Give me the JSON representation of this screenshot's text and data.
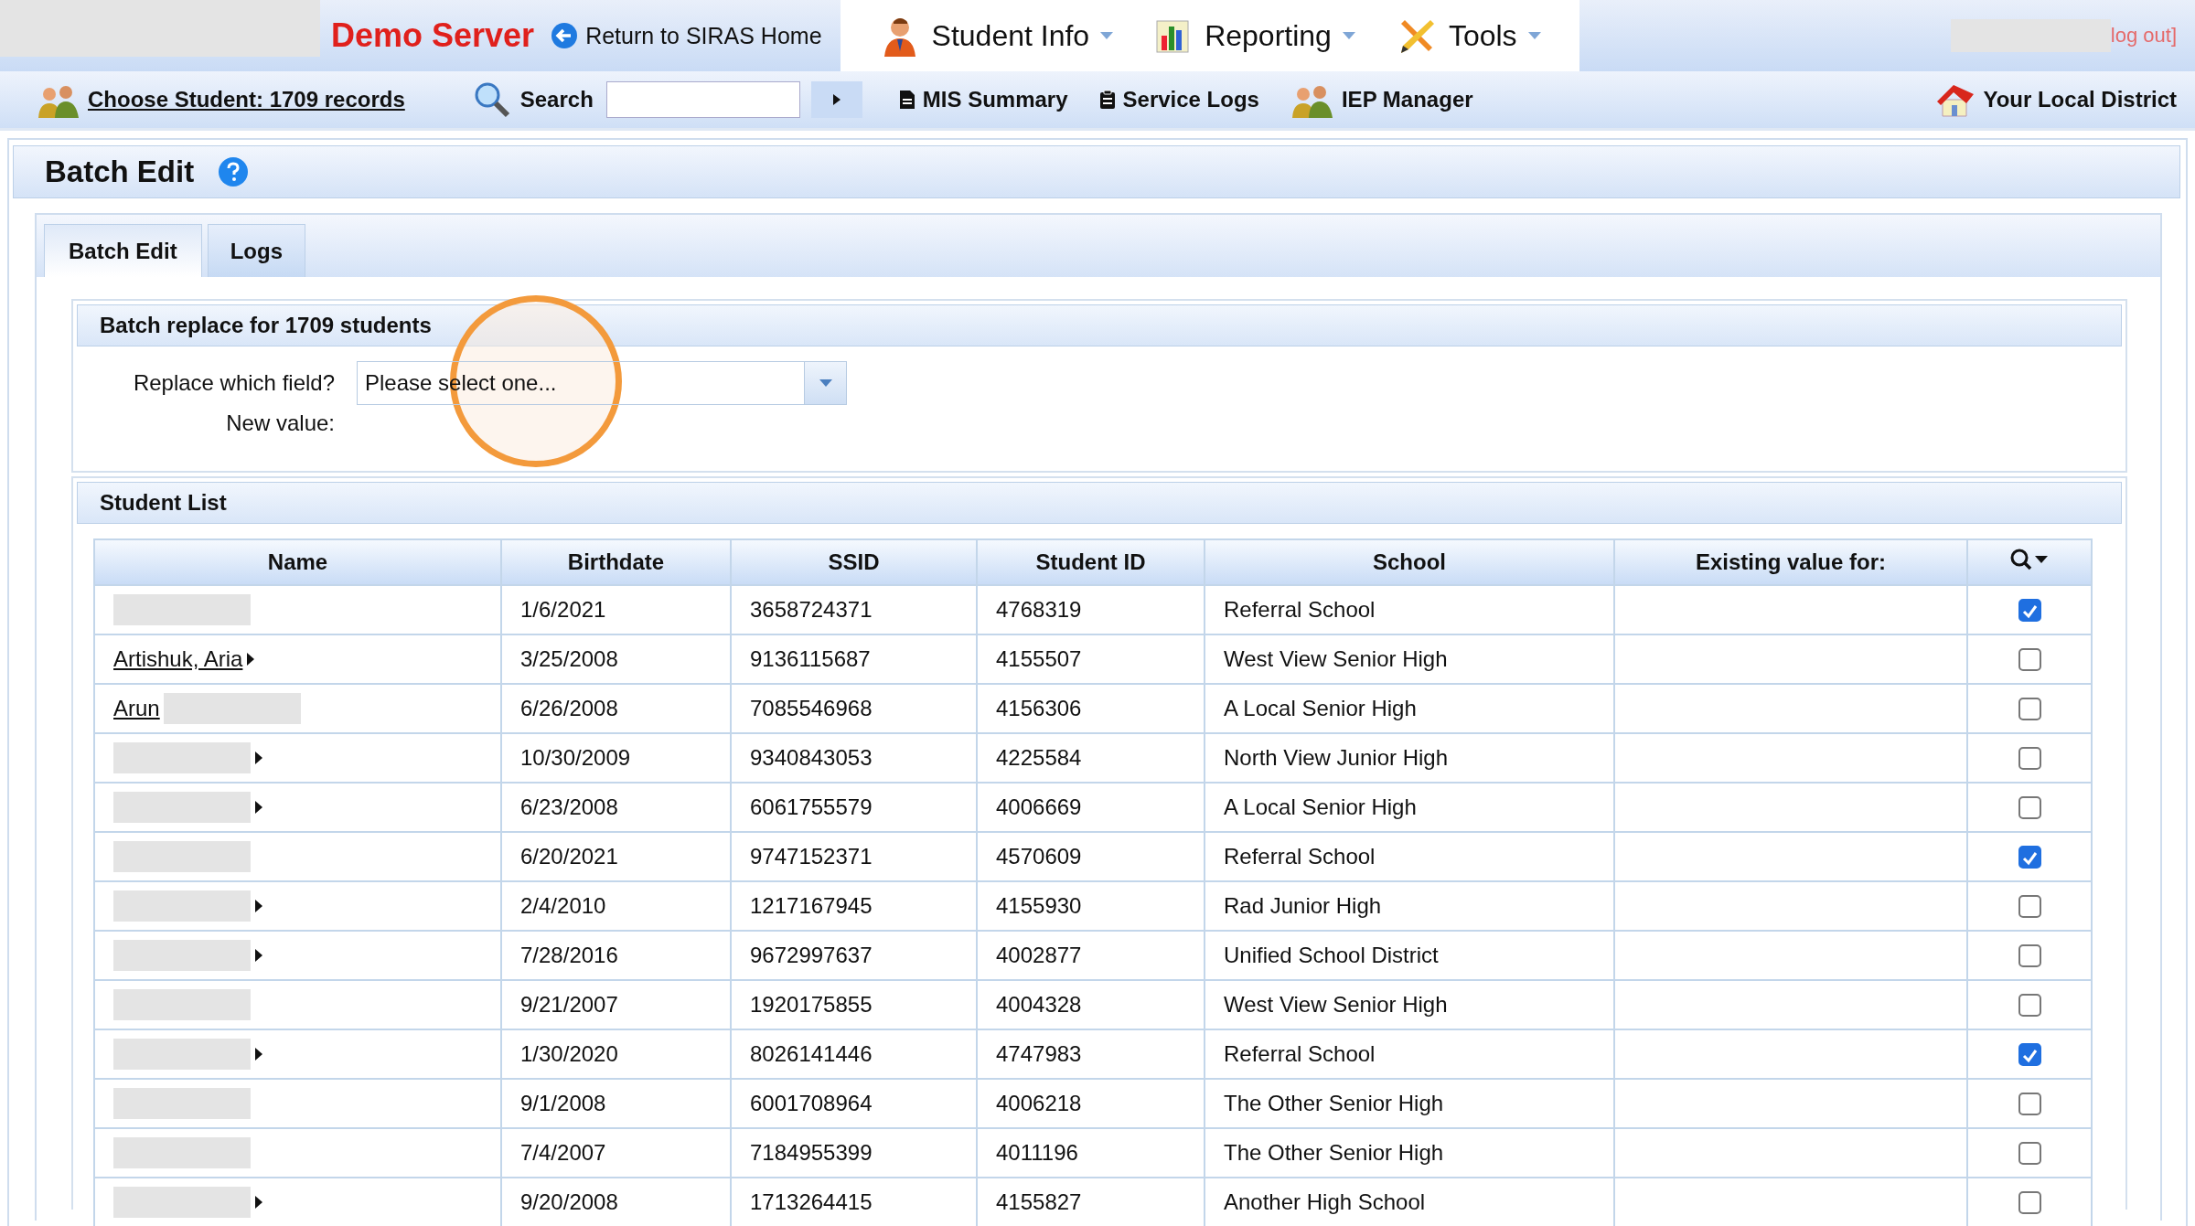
{
  "top_bar": {
    "server_label": "Demo Server",
    "return_link": "Return to SIRAS Home",
    "menus": [
      {
        "label": "Student Info"
      },
      {
        "label": "Reporting"
      },
      {
        "label": "Tools"
      }
    ],
    "logout": "log out]"
  },
  "toolbar": {
    "choose_student": "Choose Student: 1709 records",
    "search_label": "Search",
    "links": [
      {
        "label": "MIS Summary"
      },
      {
        "label": "Service Logs"
      },
      {
        "label": "IEP Manager"
      }
    ],
    "district": "Your Local District"
  },
  "page_title": "Batch Edit",
  "tabs": [
    {
      "label": "Batch Edit",
      "selected": true
    },
    {
      "label": "Logs",
      "selected": false
    }
  ],
  "batch_replace": {
    "title": "Batch replace for 1709 students",
    "field_label": "Replace which field?",
    "field_placeholder": "Please select one...",
    "new_value_label": "New value:"
  },
  "student_list": {
    "title": "Student List",
    "columns": [
      "Name",
      "Birthdate",
      "SSID",
      "Student ID",
      "School",
      "Existing value for:"
    ],
    "rows": [
      {
        "redacted": true,
        "has_menu": false,
        "birthdate": "1/6/2021",
        "ssid": "3658724371",
        "student_id": "4768319",
        "school": "Referral School",
        "checked": true
      },
      {
        "name": "Artishuk, Aria",
        "redacted": false,
        "has_menu": true,
        "birthdate": "3/25/2008",
        "ssid": "9136115687",
        "student_id": "4155507",
        "school": "West View Senior High",
        "checked": false
      },
      {
        "name": "Arun",
        "redacted": true,
        "has_menu": false,
        "birthdate": "6/26/2008",
        "ssid": "7085546968",
        "student_id": "4156306",
        "school": "A Local Senior High",
        "checked": false
      },
      {
        "redacted": true,
        "has_menu": true,
        "birthdate": "10/30/2009",
        "ssid": "9340843053",
        "student_id": "4225584",
        "school": "North View Junior High",
        "checked": false
      },
      {
        "redacted": true,
        "has_menu": true,
        "birthdate": "6/23/2008",
        "ssid": "6061755579",
        "student_id": "4006669",
        "school": "A Local Senior High",
        "checked": false
      },
      {
        "redacted": true,
        "has_menu": false,
        "birthdate": "6/20/2021",
        "ssid": "9747152371",
        "student_id": "4570609",
        "school": "Referral School",
        "checked": true
      },
      {
        "redacted": true,
        "has_menu": true,
        "birthdate": "2/4/2010",
        "ssid": "1217167945",
        "student_id": "4155930",
        "school": "Rad Junior High",
        "checked": false
      },
      {
        "redacted": true,
        "has_menu": true,
        "birthdate": "7/28/2016",
        "ssid": "9672997637",
        "student_id": "4002877",
        "school": "Unified School District",
        "checked": false
      },
      {
        "redacted": true,
        "has_menu": false,
        "birthdate": "9/21/2007",
        "ssid": "1920175855",
        "student_id": "4004328",
        "school": "West View Senior High",
        "checked": false
      },
      {
        "redacted": true,
        "has_menu": true,
        "birthdate": "1/30/2020",
        "ssid": "8026141446",
        "student_id": "4747983",
        "school": "Referral School",
        "checked": true
      },
      {
        "redacted": true,
        "has_menu": false,
        "birthdate": "9/1/2008",
        "ssid": "6001708964",
        "student_id": "4006218",
        "school": "The Other Senior High",
        "checked": false
      },
      {
        "redacted": true,
        "has_menu": false,
        "birthdate": "7/4/2007",
        "ssid": "7184955399",
        "student_id": "4011196",
        "school": "The Other Senior High",
        "checked": false
      },
      {
        "redacted": true,
        "has_menu": true,
        "birthdate": "9/20/2008",
        "ssid": "1713264415",
        "student_id": "4155827",
        "school": "Another High School",
        "checked": false
      }
    ]
  }
}
